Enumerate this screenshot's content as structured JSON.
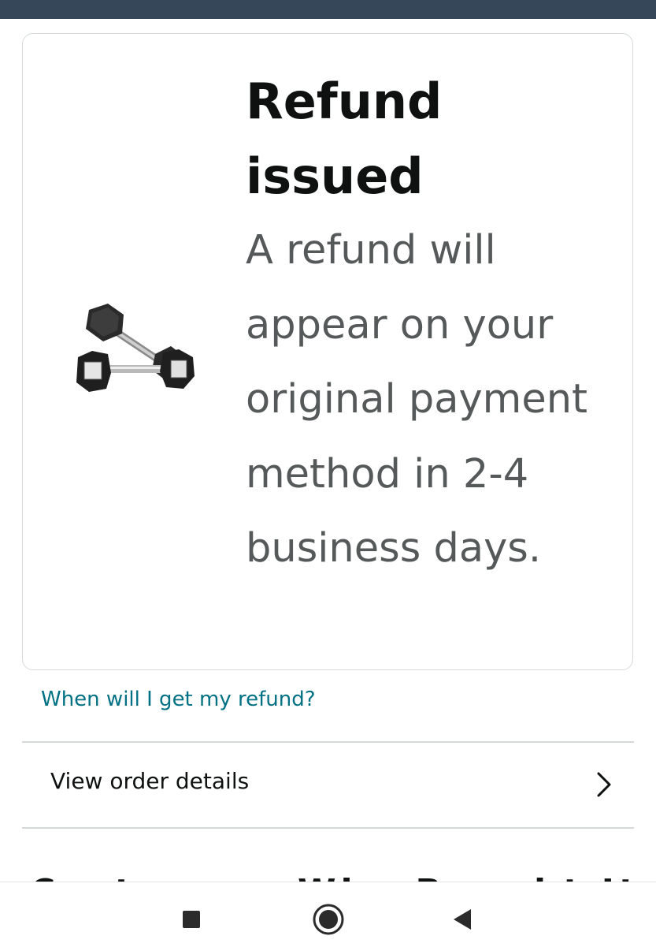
{
  "refund_card": {
    "title": "Refund issued",
    "message": "A refund will appear on your original payment method in 2-4 business days.",
    "product_image_icon": "hex-dumbbells-image"
  },
  "help_link": "When will I get my refund?",
  "order_details": {
    "label": "View order details",
    "icon": "chevron-right-icon"
  },
  "next_section_heading": "Customers Who Bought Items in",
  "nav_bar": {
    "recents_icon": "square-icon",
    "home_icon": "circle-home-icon",
    "back_icon": "triangle-back-icon"
  },
  "colors": {
    "top_bar": "#37475a",
    "link": "#007185",
    "title": "#0f1111",
    "message": "#565959",
    "border": "#d5d9d9"
  }
}
